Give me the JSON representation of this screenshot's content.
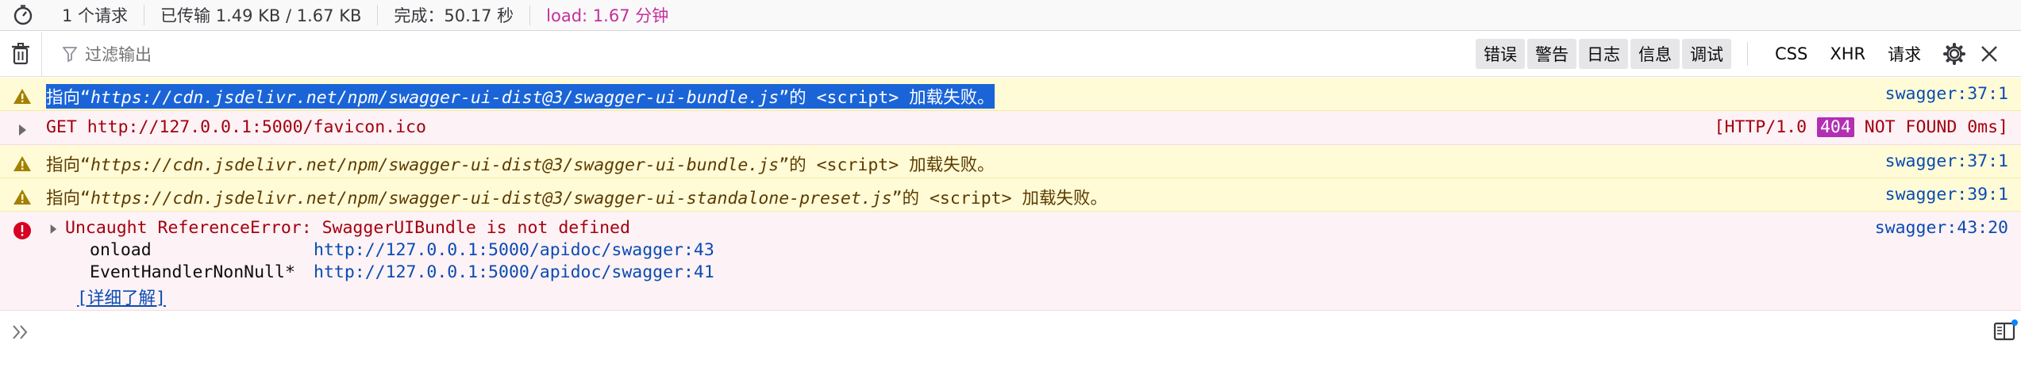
{
  "status": {
    "requests": "1 个请求",
    "transferred": "已传输 1.49 KB / 1.67 KB",
    "finish": "完成：50.17 秒",
    "load": "load: 1.67 分钟"
  },
  "toolbar": {
    "filter_placeholder": "过滤输出",
    "levels": [
      "错误",
      "警告",
      "日志",
      "信息",
      "调试"
    ],
    "categories": [
      "CSS",
      "XHR",
      "请求"
    ]
  },
  "messages": [
    {
      "type": "warning",
      "prefix": "指向“",
      "url": "https://cdn.jsdelivr.net/npm/swagger-ui-dist@3/swagger-ui-bundle.js",
      "suffix": "”的 <script> 加载失败。",
      "location": "swagger:37:1",
      "selected": true
    },
    {
      "type": "network-error",
      "text": "GET http://127.0.0.1:5000/favicon.ico",
      "status_pre": "[HTTP/1.0",
      "status_code": "404",
      "status_post": "NOT FOUND 0ms]"
    },
    {
      "type": "warning",
      "prefix": "指向“",
      "url": "https://cdn.jsdelivr.net/npm/swagger-ui-dist@3/swagger-ui-bundle.js",
      "suffix": "”的 <script> 加载失败。",
      "location": "swagger:37:1"
    },
    {
      "type": "warning",
      "prefix": "指向“",
      "url": "https://cdn.jsdelivr.net/npm/swagger-ui-dist@3/swagger-ui-standalone-preset.js",
      "suffix": "”的 <script> 加载失败。",
      "location": "swagger:39:1"
    },
    {
      "type": "error",
      "text": "Uncaught ReferenceError: SwaggerUIBundle is not defined",
      "location": "swagger:43:20",
      "stack": [
        {
          "fn": "onload",
          "url": "http://127.0.0.1:5000/apidoc/swagger:43"
        },
        {
          "fn": "EventHandlerNonNull*",
          "url": "http://127.0.0.1:5000/apidoc/swagger:41"
        }
      ],
      "learn_more": "[详细了解]"
    }
  ]
}
